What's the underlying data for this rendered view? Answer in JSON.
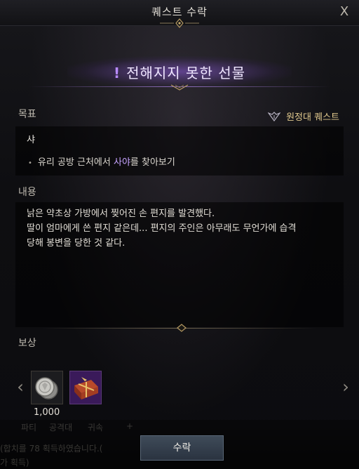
{
  "window": {
    "title": "퀘스트 수락",
    "close_label": "X"
  },
  "quest": {
    "name": "전해지지 못한 선물",
    "name_prefix": "!"
  },
  "goal": {
    "section_label": "목표",
    "type_label": "원정대 퀘스트",
    "target_title": "샤",
    "items": [
      {
        "before": "유리 공방 근처에서 ",
        "highlight": "사야",
        "after": "를 찾아보기"
      }
    ]
  },
  "content": {
    "section_label": "내용",
    "lines": [
      "낡은 약초상 가방에서 찢어진 손 편지를 발견했다.",
      "딸이 엄마에게 쓴 편지 같은데... 편지의 주인은 아무래도 무언가에 습격",
      "당해 봉변을 당한 것 같다."
    ]
  },
  "reward": {
    "section_label": "보상",
    "items": [
      {
        "icon": "silver-coin-icon",
        "quantity": "1,000"
      },
      {
        "icon": "gift-box-icon",
        "quantity": ""
      }
    ],
    "prev_arrow": "‹",
    "next_arrow": "›"
  },
  "background_chat": {
    "tabs": [
      "파티",
      "공격대",
      "귀속",
      "+"
    ],
    "line1": "(합치를 78 획득하였습니다.(",
    "line2": "가 획득)"
  },
  "actions": {
    "accept_label": "수락"
  },
  "colors": {
    "highlight": "#c6a3ff",
    "expedition": "#e1c98e",
    "banner_glow": "#8c5adc",
    "accept_bg": "#2f3947"
  }
}
